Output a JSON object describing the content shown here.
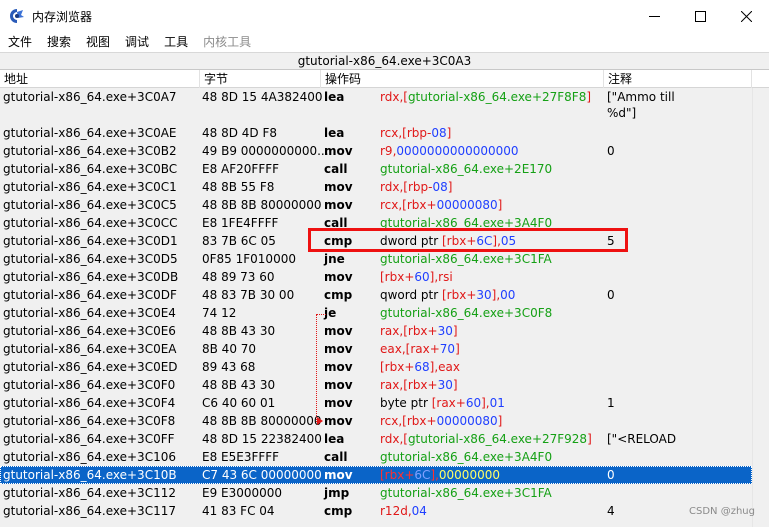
{
  "window": {
    "title": "内存浏览器",
    "icon": "cheat-engine-icon",
    "controls": [
      "minimize-icon",
      "maximize-icon",
      "close-icon"
    ]
  },
  "menu": {
    "items": [
      {
        "label": "文件",
        "enabled": true
      },
      {
        "label": "搜索",
        "enabled": true
      },
      {
        "label": "视图",
        "enabled": true
      },
      {
        "label": "调试",
        "enabled": true
      },
      {
        "label": "工具",
        "enabled": true
      },
      {
        "label": "内核工具",
        "enabled": false
      }
    ]
  },
  "address_bar": "gtutorial-x86_64.exe+3C0A3",
  "columns": {
    "address": "地址",
    "bytes": "字节",
    "opcode": "操作码",
    "comment": "注释"
  },
  "rows": [
    {
      "address": "gtutorial-x86_64.exe+3C0A7",
      "bytes": "48 8D 15 4A382400",
      "op": "lea",
      "args": [
        [
          "rdx,[",
          "red"
        ],
        [
          "gtutorial-x86_64.exe+27F8F8",
          "green"
        ],
        [
          "]",
          "red"
        ]
      ],
      "comment": "[\"Ammo till\n%d\"]"
    },
    {
      "address": "gtutorial-x86_64.exe+3C0AE",
      "bytes": "48 8D 4D F8",
      "op": "lea",
      "args": [
        [
          "rcx,[rbp-",
          "red"
        ],
        [
          "08",
          "blue"
        ],
        [
          "]",
          "red"
        ]
      ],
      "comment": ""
    },
    {
      "address": "gtutorial-x86_64.exe+3C0B2",
      "bytes": "49 B9 0000000000...",
      "op": "mov",
      "args": [
        [
          "r9,",
          "red"
        ],
        [
          "0000000000000000",
          "blue"
        ]
      ],
      "comment": "0"
    },
    {
      "address": "gtutorial-x86_64.exe+3C0BC",
      "bytes": "E8 AF20FFFF",
      "op": "call",
      "args": [
        [
          "gtutorial-x86_64.exe+2E170",
          "green"
        ]
      ],
      "comment": ""
    },
    {
      "address": "gtutorial-x86_64.exe+3C0C1",
      "bytes": "48 8B 55 F8",
      "op": "mov",
      "args": [
        [
          "rdx,[rbp-",
          "red"
        ],
        [
          "08",
          "blue"
        ],
        [
          "]",
          "red"
        ]
      ],
      "comment": ""
    },
    {
      "address": "gtutorial-x86_64.exe+3C0C5",
      "bytes": "48 8B 8B 80000000",
      "op": "mov",
      "args": [
        [
          "rcx,[rbx+",
          "red"
        ],
        [
          "00000080",
          "blue"
        ],
        [
          "]",
          "red"
        ]
      ],
      "comment": ""
    },
    {
      "address": "gtutorial-x86_64.exe+3C0CC",
      "bytes": "E8 1FE4FFFF",
      "op": "call",
      "args": [
        [
          "gtutorial-x86_64.exe+3A4F0",
          "green"
        ]
      ],
      "comment": ""
    },
    {
      "address": "gtutorial-x86_64.exe+3C0D1",
      "bytes": "83 7B 6C 05",
      "op": "cmp",
      "args": [
        [
          "dword ptr ",
          "black"
        ],
        [
          "[rbx+",
          "red"
        ],
        [
          "6C",
          "blue"
        ],
        [
          "],",
          "red"
        ],
        [
          "05",
          "blue"
        ]
      ],
      "comment": "5"
    },
    {
      "address": "gtutorial-x86_64.exe+3C0D5",
      "bytes": "0F85 1F010000",
      "op": "jne",
      "args": [
        [
          "gtutorial-x86_64.exe+3C1FA",
          "green"
        ]
      ],
      "comment": ""
    },
    {
      "address": "gtutorial-x86_64.exe+3C0DB",
      "bytes": "48 89 73 60",
      "op": "mov",
      "args": [
        [
          "[rbx+",
          "red"
        ],
        [
          "60",
          "blue"
        ],
        [
          "],rsi",
          "red"
        ]
      ],
      "comment": ""
    },
    {
      "address": "gtutorial-x86_64.exe+3C0DF",
      "bytes": "48 83 7B 30 00",
      "op": "cmp",
      "args": [
        [
          "qword ptr ",
          "black"
        ],
        [
          "[rbx+",
          "red"
        ],
        [
          "30",
          "blue"
        ],
        [
          "],",
          "red"
        ],
        [
          "00",
          "blue"
        ]
      ],
      "comment": "0"
    },
    {
      "address": "gtutorial-x86_64.exe+3C0E4",
      "bytes": "74 12",
      "op": "je",
      "args": [
        [
          "gtutorial-x86_64.exe+3C0F8",
          "green"
        ]
      ],
      "comment": ""
    },
    {
      "address": "gtutorial-x86_64.exe+3C0E6",
      "bytes": "48 8B 43 30",
      "op": "mov",
      "args": [
        [
          "rax,[rbx+",
          "red"
        ],
        [
          "30",
          "blue"
        ],
        [
          "]",
          "red"
        ]
      ],
      "comment": ""
    },
    {
      "address": "gtutorial-x86_64.exe+3C0EA",
      "bytes": "8B 40 70",
      "op": "mov",
      "args": [
        [
          "eax,[rax+",
          "red"
        ],
        [
          "70",
          "blue"
        ],
        [
          "]",
          "red"
        ]
      ],
      "comment": ""
    },
    {
      "address": "gtutorial-x86_64.exe+3C0ED",
      "bytes": "89 43 68",
      "op": "mov",
      "args": [
        [
          "[rbx+",
          "red"
        ],
        [
          "68",
          "blue"
        ],
        [
          "],eax",
          "red"
        ]
      ],
      "comment": ""
    },
    {
      "address": "gtutorial-x86_64.exe+3C0F0",
      "bytes": "48 8B 43 30",
      "op": "mov",
      "args": [
        [
          "rax,[rbx+",
          "red"
        ],
        [
          "30",
          "blue"
        ],
        [
          "]",
          "red"
        ]
      ],
      "comment": ""
    },
    {
      "address": "gtutorial-x86_64.exe+3C0F4",
      "bytes": "C6 40 60 01",
      "op": "mov",
      "args": [
        [
          "byte ptr ",
          "black"
        ],
        [
          "[rax+",
          "red"
        ],
        [
          "60",
          "blue"
        ],
        [
          "],",
          "red"
        ],
        [
          "01",
          "blue"
        ]
      ],
      "comment": "1"
    },
    {
      "address": "gtutorial-x86_64.exe+3C0F8",
      "bytes": "48 8B 8B 80000000",
      "op": "mov",
      "args": [
        [
          "rcx,[rbx+",
          "red"
        ],
        [
          "00000080",
          "blue"
        ],
        [
          "]",
          "red"
        ]
      ],
      "comment": ""
    },
    {
      "address": "gtutorial-x86_64.exe+3C0FF",
      "bytes": "48 8D 15 22382400",
      "op": "lea",
      "args": [
        [
          "rdx,[",
          "red"
        ],
        [
          "gtutorial-x86_64.exe+27F928",
          "green"
        ],
        [
          "]",
          "red"
        ]
      ],
      "comment": "[\"<RELOAD"
    },
    {
      "address": "gtutorial-x86_64.exe+3C106",
      "bytes": "E8 E5E3FFFF",
      "op": "call",
      "args": [
        [
          "gtutorial-x86_64.exe+3A4F0",
          "green"
        ]
      ],
      "comment": ""
    },
    {
      "address": "gtutorial-x86_64.exe+3C10B",
      "bytes": "C7 43 6C 00000000",
      "op": "mov",
      "args": [
        [
          "[rbx+",
          "red"
        ],
        [
          "6C",
          "blue"
        ],
        [
          "],",
          "red"
        ],
        [
          "00000000",
          "green"
        ]
      ],
      "comment": "0",
      "selected": true
    },
    {
      "address": "gtutorial-x86_64.exe+3C112",
      "bytes": "E9 E3000000",
      "op": "jmp",
      "args": [
        [
          "gtutorial-x86_64.exe+3C1FA",
          "green"
        ]
      ],
      "comment": ""
    },
    {
      "address": "gtutorial-x86_64.exe+3C117",
      "bytes": "41 83 FC 04",
      "op": "cmp",
      "args": [
        [
          "r12d,",
          "red"
        ],
        [
          "04",
          "blue"
        ]
      ],
      "comment": "4"
    }
  ],
  "watermark": "CSDN @zhug",
  "colors": {
    "selection": "#0a64c8",
    "register": "#e01818",
    "immediate": "#1f3fff",
    "address_ref": "#15a015",
    "highlight_box": "#ee1111"
  }
}
